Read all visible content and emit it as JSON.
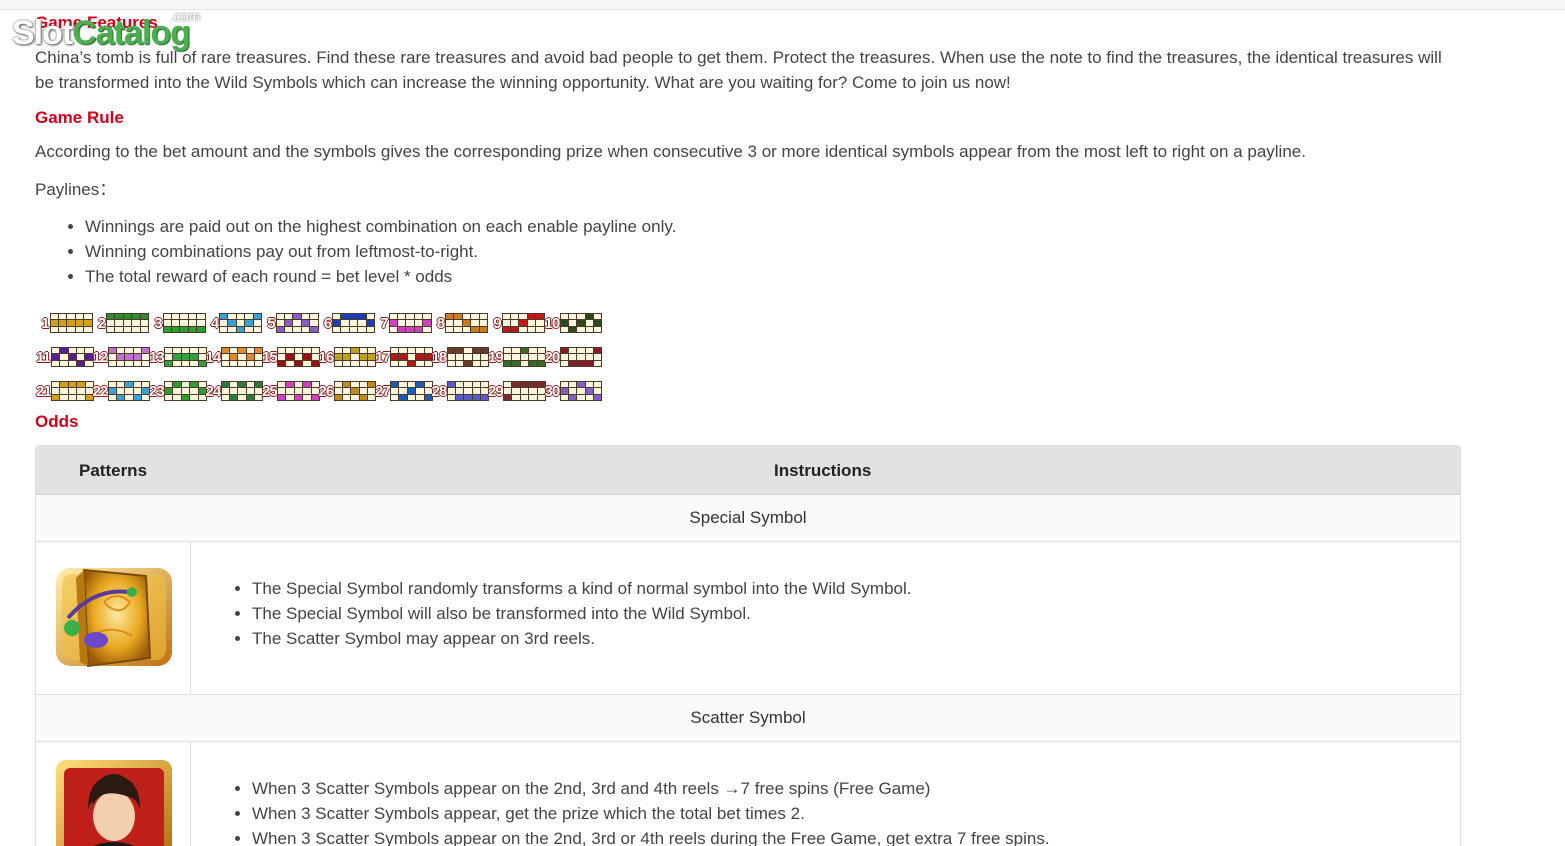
{
  "watermark": {
    "slot": "Slot",
    "catalog": "Catalog",
    "com": ".com"
  },
  "game_features": {
    "heading": "Game Features",
    "text": "China’s tomb is full of rare treasures. Find these rare treasures and avoid bad people to get them. Protect the treasures. When use the note to find the treasures, the identical treasures will be transformed into the Wild Symbols which can increase the winning opportunity. What are you waiting for? Come to join us now!"
  },
  "game_rule": {
    "heading": "Game Rule",
    "text": "According to the bet amount and the symbols gives the corresponding prize when consecutive 3 or more identical symbols appear from the most left to right on a payline.",
    "paylines_label": "Paylines："
  },
  "payline_bullets": [
    "Winnings are paid out on the highest combination on each enable payline only.",
    "Winning combinations pay out from leftmost-to-right.",
    "The total reward of each round = bet level * odds"
  ],
  "paylines": [
    {
      "n": "1",
      "color": "#d4a017",
      "rows": [
        1,
        1,
        1,
        1,
        1
      ]
    },
    {
      "n": "2",
      "color": "#2e8b2e",
      "rows": [
        0,
        0,
        0,
        0,
        0
      ]
    },
    {
      "n": "3",
      "color": "#2e9e2e",
      "rows": [
        2,
        2,
        2,
        2,
        2
      ]
    },
    {
      "n": "4",
      "color": "#3aa0d8",
      "rows": [
        0,
        1,
        2,
        1,
        0
      ]
    },
    {
      "n": "5",
      "color": "#8a5cc8",
      "rows": [
        2,
        1,
        0,
        1,
        2
      ]
    },
    {
      "n": "6",
      "color": "#1a3db8",
      "rows": [
        1,
        0,
        0,
        0,
        1
      ]
    },
    {
      "n": "7",
      "color": "#d040c0",
      "rows": [
        1,
        2,
        2,
        2,
        1
      ]
    },
    {
      "n": "8",
      "color": "#d07a20",
      "rows": [
        0,
        0,
        1,
        2,
        2
      ]
    },
    {
      "n": "9",
      "color": "#c01818",
      "rows": [
        2,
        2,
        1,
        0,
        0
      ]
    },
    {
      "n": "10",
      "color": "#2a4a1a",
      "rows": [
        1,
        2,
        1,
        0,
        1
      ]
    },
    {
      "n": "11",
      "color": "#5a1a9a",
      "rows": [
        1,
        0,
        1,
        2,
        1
      ]
    },
    {
      "n": "12",
      "color": "#c070d0",
      "rows": [
        0,
        1,
        1,
        1,
        0
      ]
    },
    {
      "n": "13",
      "color": "#30a040",
      "rows": [
        2,
        1,
        1,
        1,
        2
      ]
    },
    {
      "n": "14",
      "color": "#e08a30",
      "rows": [
        0,
        1,
        0,
        1,
        0
      ]
    },
    {
      "n": "15",
      "color": "#9a1010",
      "rows": [
        2,
        1,
        2,
        1,
        2
      ]
    },
    {
      "n": "16",
      "color": "#c0a020",
      "rows": [
        1,
        1,
        0,
        1,
        1
      ]
    },
    {
      "n": "17",
      "color": "#b01818",
      "rows": [
        1,
        1,
        2,
        1,
        1
      ]
    },
    {
      "n": "18",
      "color": "#6a3a2a",
      "rows": [
        0,
        0,
        2,
        0,
        0
      ]
    },
    {
      "n": "19",
      "color": "#3a6a2a",
      "rows": [
        2,
        2,
        0,
        2,
        2
      ]
    },
    {
      "n": "20",
      "color": "#8a1a2a",
      "rows": [
        0,
        2,
        2,
        2,
        0
      ]
    },
    {
      "n": "21",
      "color": "#d4a017",
      "rows": [
        2,
        0,
        0,
        0,
        2
      ]
    },
    {
      "n": "22",
      "color": "#3aa0d8",
      "rows": [
        1,
        2,
        0,
        2,
        1
      ]
    },
    {
      "n": "23",
      "color": "#2e9e2e",
      "rows": [
        1,
        0,
        2,
        0,
        1
      ]
    },
    {
      "n": "24",
      "color": "#2e7a3a",
      "rows": [
        0,
        2,
        0,
        2,
        0
      ]
    },
    {
      "n": "25",
      "color": "#d040c0",
      "rows": [
        2,
        0,
        2,
        0,
        2
      ]
    },
    {
      "n": "26",
      "color": "#c08a20",
      "rows": [
        2,
        0,
        1,
        2,
        0
      ]
    },
    {
      "n": "27",
      "color": "#1a5ab8",
      "rows": [
        0,
        2,
        1,
        0,
        2
      ]
    },
    {
      "n": "28",
      "color": "#5a5ac8",
      "rows": [
        0,
        2,
        2,
        2,
        2
      ]
    },
    {
      "n": "29",
      "color": "#7a2a2a",
      "rows": [
        2,
        0,
        0,
        0,
        0
      ]
    },
    {
      "n": "30",
      "color": "#8a5cc8",
      "rows": [
        1,
        2,
        0,
        1,
        2
      ]
    }
  ],
  "odds": {
    "heading": "Odds",
    "col_patterns": "Patterns",
    "col_instructions": "Instructions",
    "special": {
      "title": "Special Symbol",
      "icon": "golden-book-icon",
      "bullets": [
        "The Special Symbol randomly transforms a kind of normal symbol into the Wild Symbol.",
        "The Special Symbol will also be transformed into the Wild Symbol.",
        "The Scatter Symbol may appear on 3rd reels."
      ]
    },
    "scatter": {
      "title": "Scatter Symbol",
      "icon": "young-man-portrait-icon",
      "bullets": [
        "When 3 Scatter Symbols appear on the 2nd, 3rd and 4th reels →7 free spins (Free Game)",
        "When 3 Scatter Symbols appear, get the prize which the total bet times 2.",
        "When 3 Scatter Symbols appear on the 2nd, 3rd or 4th reels during the Free Game, get extra 7 free spins."
      ]
    }
  }
}
